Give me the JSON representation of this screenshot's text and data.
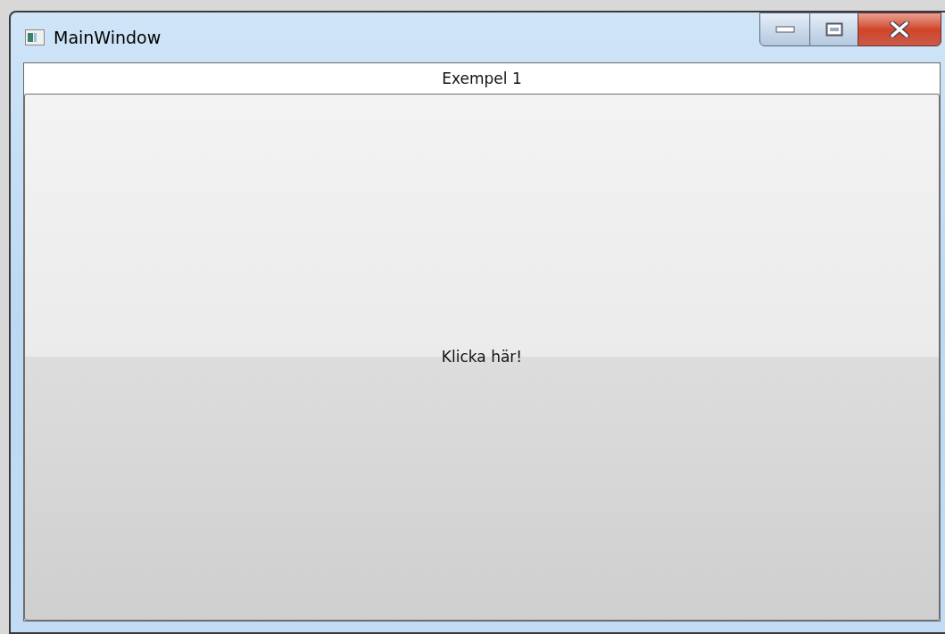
{
  "window": {
    "title": "MainWindow",
    "controls": [
      {
        "kind": "minimize"
      },
      {
        "kind": "maximize"
      },
      {
        "kind": "close"
      }
    ]
  },
  "label": "Exempel 1",
  "button": "Klicka här!"
}
